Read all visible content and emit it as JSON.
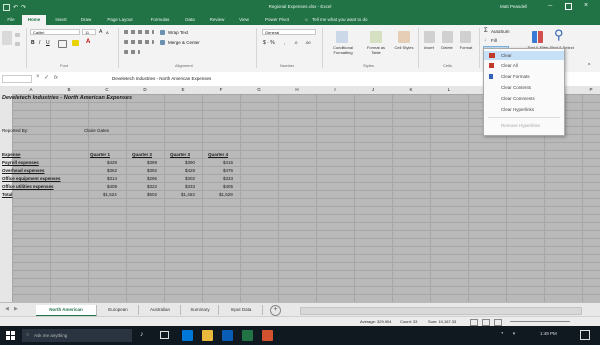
{
  "window": {
    "title": "Regional Expenses.xlsx - Excel",
    "user": "Matt Peasdell"
  },
  "ribbon_tabs": [
    "File",
    "Home",
    "Insert",
    "Draw",
    "Page Layout",
    "Formulas",
    "Data",
    "Review",
    "View",
    "Power Pivot"
  ],
  "tell_me": "Tell me what you want to do",
  "ribbon": {
    "font_name": "Calibri",
    "font_size": "11",
    "wrap_text": "Wrap Text",
    "merge_center": "Merge & Center",
    "number_format": "General",
    "conditional_formatting": "Conditional Formatting",
    "format_as_table": "Format as Table",
    "cell_styles": "Cell Styles",
    "insert": "Insert",
    "delete": "Delete",
    "format": "Format",
    "autosum": "AutoSum",
    "fill": "Fill",
    "clear": "Clear",
    "sort_filter": "Sort & Filter",
    "find_select": "Find & Select",
    "groups": [
      "Font",
      "Alignment",
      "Number",
      "Styles",
      "Cells"
    ]
  },
  "formula_bar": {
    "content": "Develetech Industries - North American Expenses"
  },
  "columns": [
    "A",
    "B",
    "C",
    "D",
    "E",
    "F",
    "G",
    "H",
    "I",
    "J",
    "K",
    "L",
    "M",
    "N",
    "O",
    "P"
  ],
  "sheet": {
    "title": "Develetech Industries - North American Expenses",
    "reported_by_label": "Reported By:",
    "reported_by_value": "Claire Gates",
    "headers": [
      "Expense",
      "Quarter 1",
      "Quarter 2",
      "Quarter 3",
      "Quarter 4"
    ],
    "rows": [
      {
        "label": "Payroll expenses",
        "q1": "$429",
        "q2": "$399",
        "q3": "$390",
        "q4": "$415"
      },
      {
        "label": "Overhead expenses",
        "q1": "$362",
        "q2": "$392",
        "q3": "$428",
        "q4": "$476"
      },
      {
        "label": "Office equipment expenses",
        "q1": "$314",
        "q2": "$296",
        "q3": "$302",
        "q4": "$333"
      },
      {
        "label": "Office utilities expenses",
        "q1": "$409",
        "q2": "$322",
        "q3": "$333",
        "q4": "$405"
      },
      {
        "label": "Total",
        "q1": "$1,524",
        "q2": "$502",
        "q3": "$1,453",
        "q4": "$1,629"
      }
    ]
  },
  "clear_menu": {
    "header": "Clear",
    "items": [
      "Clear All",
      "Clear Formats",
      "Clear Contents",
      "Clear Comments",
      "Clear Hyperlinks",
      "Remove Hyperlinks"
    ]
  },
  "sheet_tabs": [
    "North American",
    "European",
    "Australian",
    "Summary",
    "Input Data"
  ],
  "status_bar": {
    "average": "Average: 329.904",
    "count": "Count: 33",
    "sum": "Sum: 10,167.33"
  },
  "taskbar": {
    "search": "Ask me anything",
    "time": "1:49 PM"
  },
  "colors": {
    "accent": "#217346",
    "menu_highlight": "#c5e0f7"
  }
}
